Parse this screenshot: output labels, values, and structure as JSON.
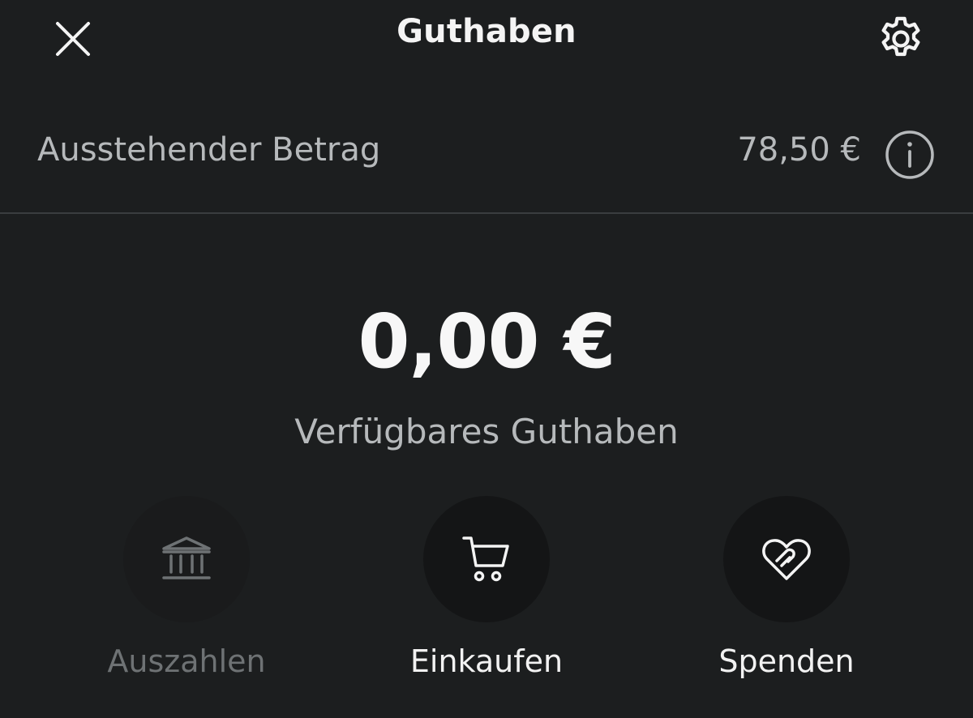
{
  "header": {
    "title": "Guthaben",
    "close_icon": "close-icon",
    "settings_icon": "gear-icon"
  },
  "outstanding": {
    "label": "Ausstehender Betrag",
    "amount": "78,50 €",
    "info_icon": "info-icon"
  },
  "balance": {
    "amount": "0,00 €",
    "label": "Verfügbares Guthaben"
  },
  "actions": [
    {
      "label": "Auszahlen",
      "icon": "bank-icon",
      "state": "disabled"
    },
    {
      "label": "Einkaufen",
      "icon": "cart-icon",
      "state": "enabled"
    },
    {
      "label": "Spenden",
      "icon": "heart-icon",
      "state": "enabled"
    }
  ],
  "colors": {
    "background": "#1c1e1f",
    "text_primary": "#f4f4f4",
    "text_secondary": "#b6b9bb",
    "text_disabled": "#6e7274",
    "action_circle": "#141516",
    "divider": "#3a3d3f"
  }
}
